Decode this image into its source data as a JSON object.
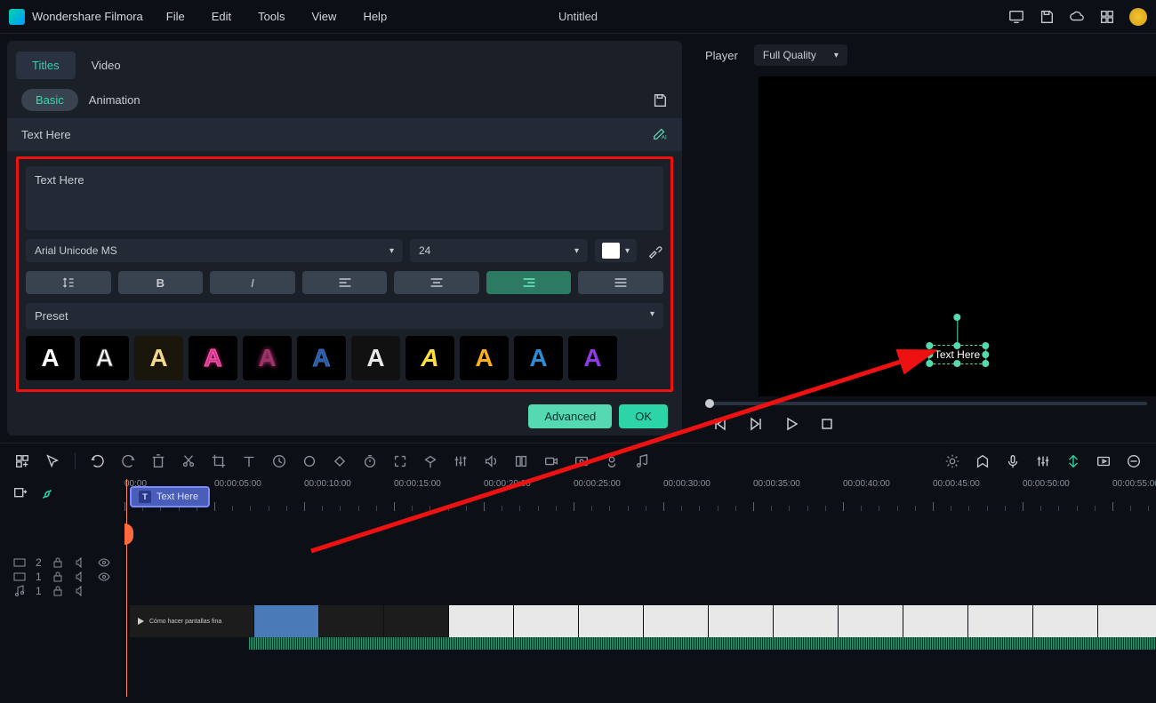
{
  "app": {
    "title": "Wondershare Filmora"
  },
  "menu": [
    "File",
    "Edit",
    "Tools",
    "View",
    "Help"
  ],
  "doc": {
    "title": "Untitled"
  },
  "panel": {
    "tabs": [
      "Titles",
      "Video"
    ],
    "subtabs": {
      "basic": "Basic",
      "animation": "Animation"
    },
    "header": "Text Here",
    "input_value": "Text Here",
    "font": "Arial Unicode MS",
    "size": "24",
    "preset_label": "Preset",
    "presets": [
      "A",
      "A",
      "A",
      "A",
      "A",
      "A",
      "A",
      "A",
      "A",
      "A",
      "A"
    ],
    "buttons": {
      "advanced": "Advanced",
      "ok": "OK"
    }
  },
  "player": {
    "label": "Player",
    "quality": "Full Quality",
    "overlay_text": "Text Here"
  },
  "timeline": {
    "marks": [
      "00:00",
      "00:00:05:00",
      "00:00:10:00",
      "00:00:15:00",
      "00:00:20:00",
      "00:00:25:00",
      "00:00:30:00",
      "00:00:35:00",
      "00:00:40:00",
      "00:00:45:00",
      "00:00:50:00",
      "00:00:55:00"
    ],
    "title_clip": "Text Here",
    "video_label": "Cómo hacer pantallas fina",
    "tracks": {
      "t2": "2",
      "t1": "1",
      "a1": "1"
    }
  }
}
